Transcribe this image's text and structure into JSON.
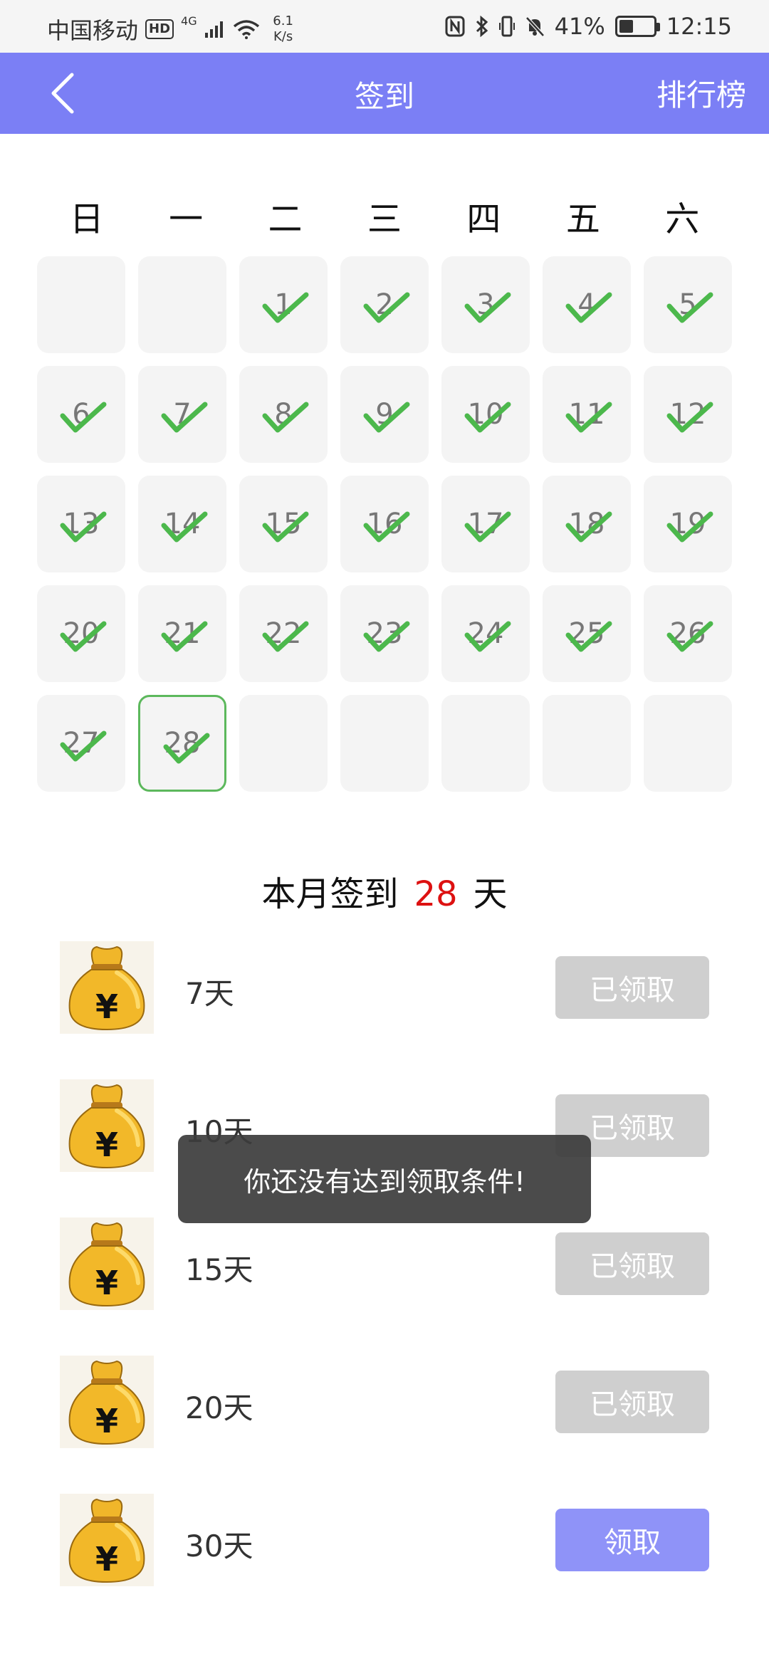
{
  "status_bar": {
    "carrier": "中国移动",
    "hd": "HD",
    "net_type": "4G",
    "speed_value": "6.1",
    "speed_unit": "K/s",
    "battery_percent": "41%",
    "battery_level": 0.41,
    "time": "12:15"
  },
  "header": {
    "title": "签到",
    "right_action": "排行榜",
    "background_color": "#7b7ff5"
  },
  "calendar": {
    "weekdays": [
      "日",
      "一",
      "二",
      "三",
      "四",
      "五",
      "六"
    ],
    "leading_blanks": 2,
    "trailing_blanks": 5,
    "days": [
      {
        "day": "1",
        "checked": true
      },
      {
        "day": "2",
        "checked": true
      },
      {
        "day": "3",
        "checked": true
      },
      {
        "day": "4",
        "checked": true
      },
      {
        "day": "5",
        "checked": true
      },
      {
        "day": "6",
        "checked": true
      },
      {
        "day": "7",
        "checked": true
      },
      {
        "day": "8",
        "checked": true
      },
      {
        "day": "9",
        "checked": true
      },
      {
        "day": "10",
        "checked": true
      },
      {
        "day": "11",
        "checked": true
      },
      {
        "day": "12",
        "checked": true
      },
      {
        "day": "13",
        "checked": true
      },
      {
        "day": "14",
        "checked": true
      },
      {
        "day": "15",
        "checked": true
      },
      {
        "day": "16",
        "checked": true
      },
      {
        "day": "17",
        "checked": true
      },
      {
        "day": "18",
        "checked": true
      },
      {
        "day": "19",
        "checked": true
      },
      {
        "day": "20",
        "checked": true
      },
      {
        "day": "21",
        "checked": true
      },
      {
        "day": "22",
        "checked": true
      },
      {
        "day": "23",
        "checked": true
      },
      {
        "day": "24",
        "checked": true
      },
      {
        "day": "25",
        "checked": true
      },
      {
        "day": "26",
        "checked": true
      },
      {
        "day": "27",
        "checked": true
      },
      {
        "day": "28",
        "checked": true,
        "today": true
      }
    ],
    "check_color": "#4cb84c"
  },
  "summary": {
    "prefix": "本月签到",
    "count": "28",
    "suffix": "天",
    "count_color": "#dd1111"
  },
  "rewards": [
    {
      "label": "7天",
      "button": "已领取",
      "state": "claimed",
      "icon": "money-bag-icon"
    },
    {
      "label": "10天",
      "button": "已领取",
      "state": "claimed",
      "icon": "money-bag-icon"
    },
    {
      "label": "15天",
      "button": "已领取",
      "state": "claimed",
      "icon": "money-bag-icon"
    },
    {
      "label": "20天",
      "button": "已领取",
      "state": "claimed",
      "icon": "money-bag-icon"
    },
    {
      "label": "30天",
      "button": "领取",
      "state": "active",
      "icon": "money-bag-icon"
    }
  ],
  "toast": {
    "message": "你还没有达到领取条件!"
  }
}
